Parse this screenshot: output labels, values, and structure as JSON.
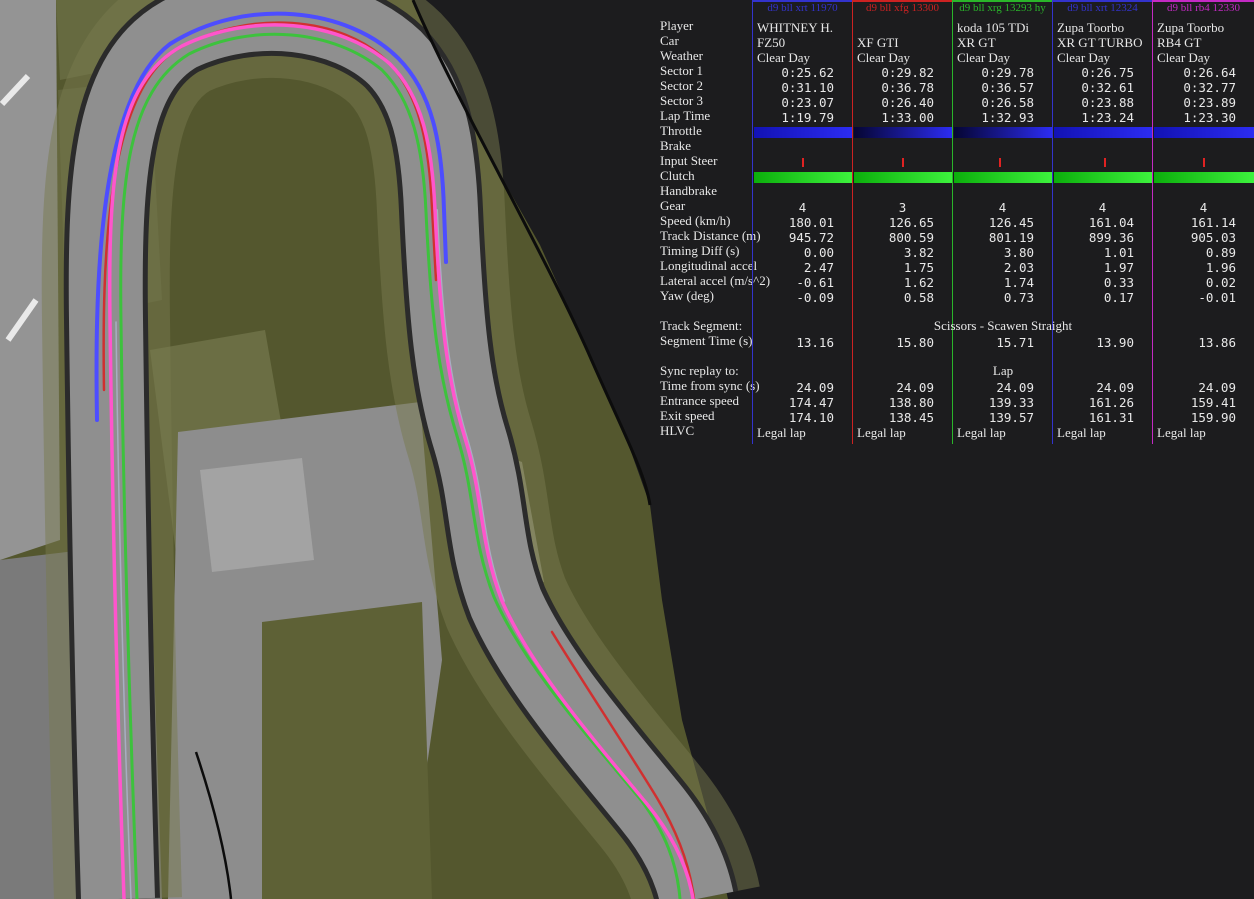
{
  "map": {
    "line_colors": {
      "pink": "#ff55cc",
      "green": "#3dc23d",
      "blue": "#4d4dff",
      "red": "#d03030",
      "gray": "#a8aec2"
    }
  },
  "table": {
    "row_labels": [
      "Player",
      "Car",
      "Weather",
      "Sector 1",
      "Sector 2",
      "Sector 3",
      "Lap Time",
      "Throttle",
      "Brake",
      "Input Steer",
      "Clutch",
      "Handbrake",
      "Gear",
      "Speed (km/h)",
      "Track Distance (m)",
      "Timing Diff (s)",
      "Longitudinal accel",
      "Lateral accel (m/s^2)",
      "Yaw (deg)",
      "",
      "Track Segment:",
      "Segment Time (s)",
      "",
      "Sync replay to:",
      "Time from sync (s)",
      "Entrance speed",
      "Exit speed",
      "HLVC"
    ],
    "track_segment_value": "Scissors - Scawen Straight",
    "sync_value": "Lap",
    "columns": [
      {
        "header": "d9 bll xrt 11970",
        "color": "#3333cc",
        "player": "WHITNEY H.",
        "car": "FZ50",
        "weather": "Clear Day",
        "sector1": "0:25.62",
        "sector2": "0:31.10",
        "sector3": "0:23.07",
        "lap_time": "1:19.79",
        "throttle": 1,
        "throttle_ramp": false,
        "brake": 0,
        "steer": 0.5,
        "clutch": 1,
        "handbrake": 0,
        "gear": "4",
        "speed": "180.01",
        "track_distance": "945.72",
        "timing_diff": "0.00",
        "long_accel": "2.47",
        "lat_accel": "-0.61",
        "yaw": "-0.09",
        "segment_time": "13.16",
        "time_from_sync": "24.09",
        "entrance_speed": "174.47",
        "exit_speed": "174.10",
        "hlvc": "Legal lap"
      },
      {
        "header": "d9 bll xfg 13300",
        "color": "#cc2222",
        "player": "",
        "car": "XF GTI",
        "weather": "Clear Day",
        "sector1": "0:29.82",
        "sector2": "0:36.78",
        "sector3": "0:26.40",
        "lap_time": "1:33.00",
        "throttle": 1,
        "throttle_ramp": true,
        "brake": 0,
        "steer": 0.5,
        "clutch": 1,
        "handbrake": 0,
        "gear": "3",
        "speed": "126.65",
        "track_distance": "800.59",
        "timing_diff": "3.82",
        "long_accel": "1.75",
        "lat_accel": "1.62",
        "yaw": "0.58",
        "segment_time": "15.80",
        "time_from_sync": "24.09",
        "entrance_speed": "138.80",
        "exit_speed": "138.45",
        "hlvc": "Legal lap"
      },
      {
        "header": "d9 bll xrg 13293 hy",
        "color": "#2ab52a",
        "player": "koda 105 TDi",
        "car": "XR GT",
        "weather": "Clear Day",
        "sector1": "0:29.78",
        "sector2": "0:36.57",
        "sector3": "0:26.58",
        "lap_time": "1:32.93",
        "throttle": 1,
        "throttle_ramp": true,
        "brake": 0,
        "steer": 0.47,
        "clutch": 1,
        "handbrake": 0,
        "gear": "4",
        "speed": "126.45",
        "track_distance": "801.19",
        "timing_diff": "3.80",
        "long_accel": "2.03",
        "lat_accel": "1.74",
        "yaw": "0.73",
        "segment_time": "15.71",
        "time_from_sync": "24.09",
        "entrance_speed": "139.33",
        "exit_speed": "139.57",
        "hlvc": "Legal lap"
      },
      {
        "header": "d9 bll xrt 12324",
        "color": "#3333cc",
        "player": "Zupa Toorbo",
        "car": "XR GT TURBO",
        "weather": "Clear Day",
        "sector1": "0:26.75",
        "sector2": "0:32.61",
        "sector3": "0:23.88",
        "lap_time": "1:23.24",
        "throttle": 1,
        "throttle_ramp": false,
        "brake": 0,
        "steer": 0.52,
        "clutch": 1,
        "handbrake": 0,
        "gear": "4",
        "speed": "161.04",
        "track_distance": "899.36",
        "timing_diff": "1.01",
        "long_accel": "1.97",
        "lat_accel": "0.33",
        "yaw": "0.17",
        "segment_time": "13.90",
        "time_from_sync": "24.09",
        "entrance_speed": "161.26",
        "exit_speed": "161.31",
        "hlvc": "Legal lap"
      },
      {
        "header": "d9 bll rb4 12330",
        "color": "#c32ac3",
        "player": "Zupa Toorbo",
        "car": "RB4 GT",
        "weather": "Clear Day",
        "sector1": "0:26.64",
        "sector2": "0:32.77",
        "sector3": "0:23.89",
        "lap_time": "1:23.30",
        "throttle": 1,
        "throttle_ramp": false,
        "brake": 0,
        "steer": 0.5,
        "clutch": 1,
        "handbrake": 0,
        "gear": "4",
        "speed": "161.14",
        "track_distance": "905.03",
        "timing_diff": "0.89",
        "long_accel": "1.96",
        "lat_accel": "0.02",
        "yaw": "-0.01",
        "segment_time": "13.86",
        "time_from_sync": "24.09",
        "entrance_speed": "159.41",
        "exit_speed": "159.90",
        "hlvc": "Legal lap"
      }
    ]
  }
}
